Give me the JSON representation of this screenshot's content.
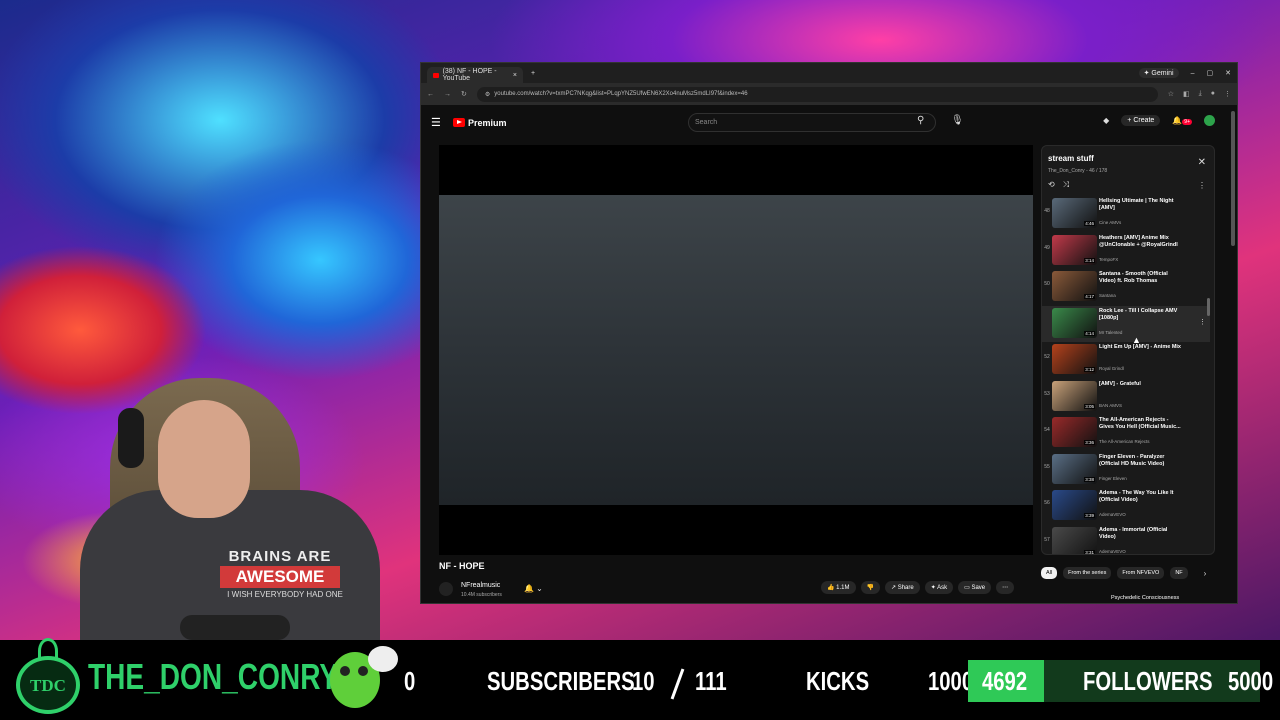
{
  "browser": {
    "tab_title": "(38) NF - HOPE - YouTube",
    "gemini_label": "Gemini",
    "url": "youtube.com/watch?v=txmPC7NKqg&list=PLqpYNZ5UfwEN6X2Xo4nuMsz5mdLI97f&index=46"
  },
  "youtube": {
    "logo_label": "Premium",
    "search_placeholder": "Search",
    "create_label": "Create",
    "notification_count": "9+"
  },
  "video": {
    "title": "NF - HOPE",
    "channel": "NFrealmusic",
    "subscribers": "10.4M subscribers",
    "likes": "1.1M",
    "share_label": "Share",
    "ask_label": "Ask",
    "save_label": "Save"
  },
  "playlist": {
    "title": "stream stuff",
    "subtitle": "The_Don_Conry - 46 / 178",
    "items": [
      {
        "num": "48",
        "title": "Hellsing Ultimate | The Night [AMV]",
        "channel": "Cine AMVs",
        "duration": "4:46",
        "color": "#5a6a7a"
      },
      {
        "num": "49",
        "title": "Heathers [AMV] Anime Mix @UnClonable + @RoyalGrindl",
        "channel": "TempoFX",
        "duration": "3:14",
        "color": "#c23a4a"
      },
      {
        "num": "50",
        "title": "Santana - Smooth (Official Video) ft. Rob Thomas",
        "channel": "Santana",
        "duration": "4:17",
        "color": "#8a5a3a"
      },
      {
        "num": "",
        "title": "Rock Lee - Till I Collapse AMV [1080p]",
        "channel": "Mr Talented",
        "duration": "4:14",
        "color": "#3a8a4a"
      },
      {
        "num": "52",
        "title": "Light Em Up [AMV] - Anime Mix",
        "channel": "Royal Grindl",
        "duration": "3:12",
        "color": "#b5421c"
      },
      {
        "num": "53",
        "title": "[AMV] - Grateful",
        "channel": "BAN AMVS",
        "duration": "3:05",
        "color": "#c9a27a"
      },
      {
        "num": "54",
        "title": "The All-American Rejects - Gives You Hell (Official Music...",
        "channel": "The All-American Rejects",
        "duration": "3:36",
        "color": "#9a2a2a"
      },
      {
        "num": "55",
        "title": "Finger Eleven - Paralyzer (Official HD Music Video)",
        "channel": "Finger Eleven",
        "duration": "3:38",
        "color": "#5a6f86"
      },
      {
        "num": "56",
        "title": "Adema - The Way You Like It (Official Video)",
        "channel": "AdemaVEVO",
        "duration": "3:39",
        "color": "#2a4a8a"
      },
      {
        "num": "57",
        "title": "Adema - Immortal (Official Video)",
        "channel": "AdemaVEVO",
        "duration": "3:31",
        "color": "#4a4a4a"
      }
    ]
  },
  "chips": [
    "All",
    "From the series",
    "From NFVEVO",
    "NF"
  ],
  "next_video_title": "Psychedelic Consciousness",
  "overlay": {
    "name": "THE_DON_CONRY",
    "logo_text": "TDC",
    "subscribers_count": "0",
    "subscribers_label": "SUBSCRIBERS",
    "kicks_current": "10",
    "kicks_goal": "111",
    "kicks_label": "KICKS",
    "kicks_target": "10000",
    "followers_count": "4692",
    "followers_label": "FOLLOWERS",
    "followers_goal": "5000",
    "followers_progress": 0.26
  },
  "shirt": {
    "line1": "BRAINS ARE",
    "line2": "AWESOME",
    "line3": "I WISH EVERYBODY HAD ONE"
  },
  "colors": {
    "accent_green": "#2fc957",
    "youtube_red": "#ff0000"
  }
}
